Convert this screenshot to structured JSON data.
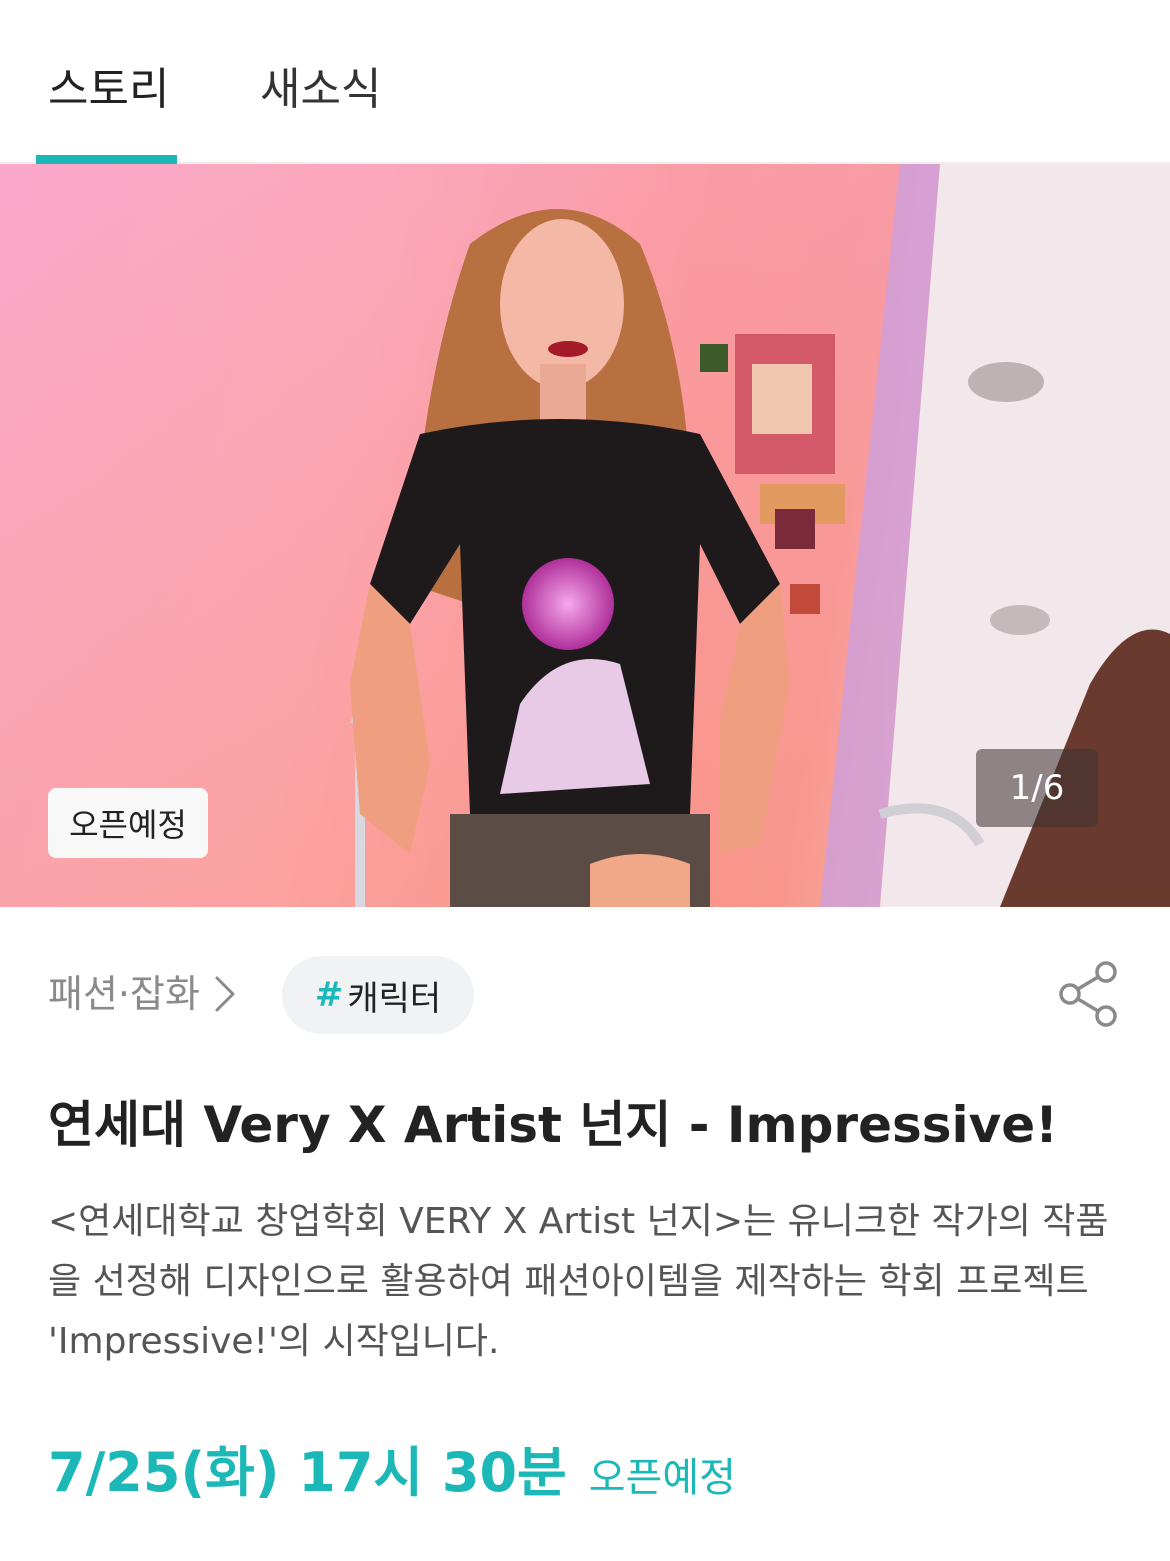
{
  "tabs": [
    {
      "label": "스토리",
      "active": true
    },
    {
      "label": "새소식",
      "active": false
    }
  ],
  "hero": {
    "badge": "오픈예정",
    "counter": "1/6"
  },
  "category": {
    "breadcrumb": "패션·잡화",
    "tag_hash": "#",
    "tag_label": "캐릭터"
  },
  "icons": {
    "chevron": "chevron-right-icon",
    "share": "share-icon"
  },
  "title": "연세대 Very X Artist 넌지 - Impressive!",
  "description": "<연세대학교 창업학회 VERY X Artist 넌지>는 유니크한 작가의 작품을 선정해 디자인으로 활용하여 패션아이템을 제작하는 학회 프로젝트 'Impressive!'의 시작입니다.",
  "open": {
    "date": "7/25(화) 17시 30분",
    "label": "오픈예정"
  },
  "colors": {
    "accent": "#1cb8b8"
  }
}
